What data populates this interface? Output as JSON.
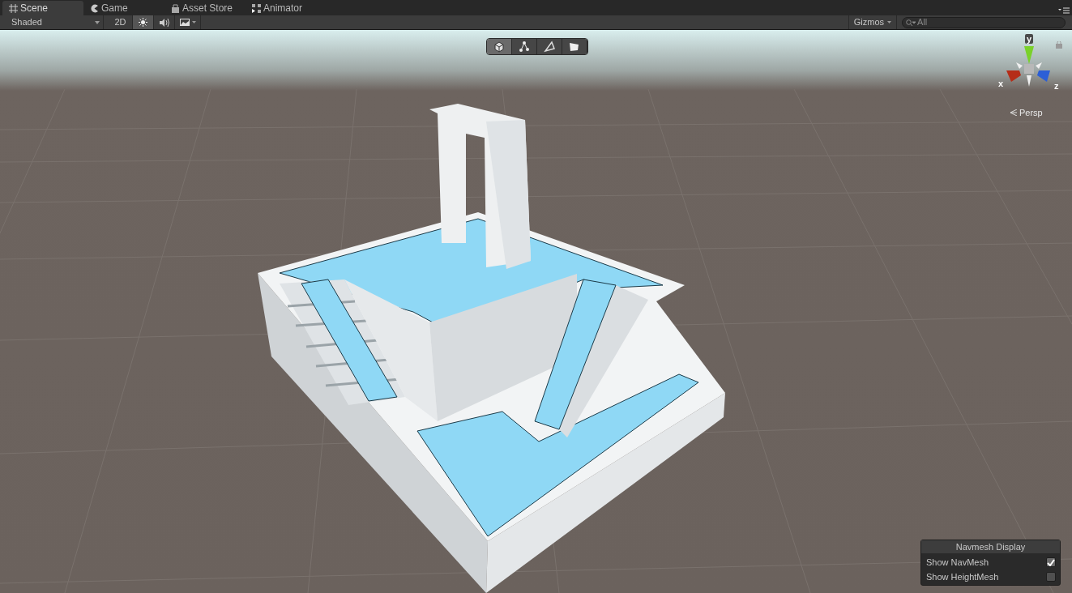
{
  "tabs": [
    {
      "label": "Scene",
      "selected": true
    },
    {
      "label": "Game",
      "selected": false
    },
    {
      "label": "Asset Store",
      "selected": false
    },
    {
      "label": "Animator",
      "selected": false
    }
  ],
  "toolbar": {
    "shading": "Shaded",
    "mode_2d": {
      "label": "2D",
      "selected": false
    },
    "lighting": {
      "selected": true
    },
    "audio": {
      "selected": false
    },
    "effects": {
      "selected": false
    },
    "gizmos": "Gizmos",
    "search": {
      "placeholder": "All"
    }
  },
  "scene": {
    "tools": [
      {
        "kind": "cube",
        "selected": true
      },
      {
        "kind": "nodes",
        "selected": false
      },
      {
        "kind": "triangle",
        "selected": false
      },
      {
        "kind": "quad",
        "selected": false
      }
    ],
    "gizmo": {
      "y": "y",
      "x": "x",
      "z": "z",
      "projection": "Persp"
    }
  },
  "navmesh_display": {
    "title": "Navmesh Display",
    "rows": [
      {
        "label": "Show NavMesh",
        "checked": true
      },
      {
        "label": "Show HeightMesh",
        "checked": false
      }
    ]
  }
}
